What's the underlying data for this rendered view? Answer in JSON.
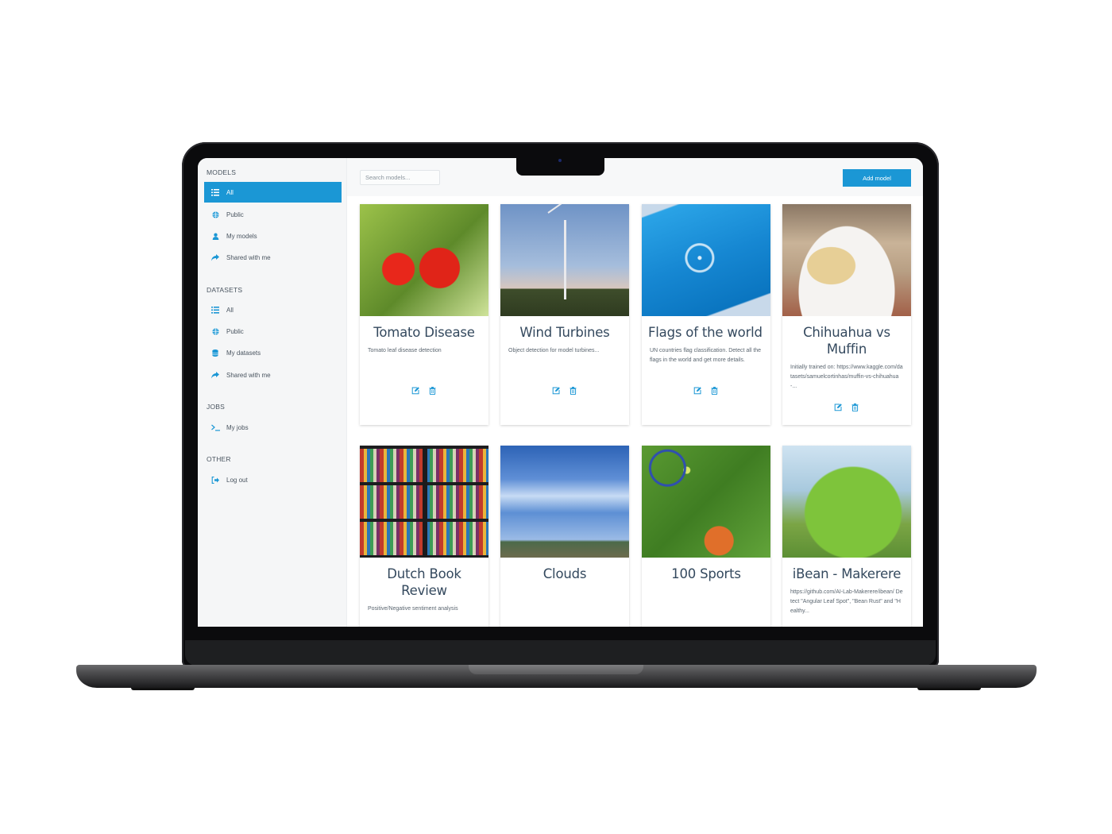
{
  "sidebar": {
    "sections": [
      {
        "title": "MODELS",
        "items": [
          {
            "label": "All",
            "icon": "list-icon",
            "active": true
          },
          {
            "label": "Public",
            "icon": "globe-icon"
          },
          {
            "label": "My models",
            "icon": "user-icon"
          },
          {
            "label": "Shared with me",
            "icon": "share-icon"
          }
        ]
      },
      {
        "title": "DATASETS",
        "items": [
          {
            "label": "All",
            "icon": "list-icon"
          },
          {
            "label": "Public",
            "icon": "globe-icon"
          },
          {
            "label": "My datasets",
            "icon": "database-icon"
          },
          {
            "label": "Shared with me",
            "icon": "share-icon"
          }
        ]
      },
      {
        "title": "JOBS",
        "items": [
          {
            "label": "My jobs",
            "icon": "terminal-icon"
          }
        ]
      },
      {
        "title": "OTHER",
        "items": [
          {
            "label": "Log out",
            "icon": "sign-out-icon"
          }
        ]
      }
    ]
  },
  "topbar": {
    "search_placeholder": "Search models...",
    "search_value": "",
    "add_button_label": "Add model"
  },
  "colors": {
    "accent": "#1b97d5",
    "title_text": "#34495e",
    "sidebar_bg": "#f5f6f7"
  },
  "models": [
    {
      "title": "Tomato Disease",
      "description": "Tomato leaf disease detection",
      "image": "tomatoes"
    },
    {
      "title": "Wind Turbines",
      "description": "Object detection for model turbines...",
      "image": "wind-turbines"
    },
    {
      "title": "Flags of the world",
      "description": "UN countries flag classification. Detect all the flags in the world and get more details.",
      "image": "un-flag"
    },
    {
      "title": "Chihuahua vs Muffin",
      "description": "Initially trained on: https://www.kaggle.com/datasets/samuelcortinhas/muffin-vs-chihuahua-...",
      "image": "muffin"
    },
    {
      "title": "Dutch Book Review",
      "description": "Positive/Negative sentiment analysis",
      "image": "bookshelf"
    },
    {
      "title": "Clouds",
      "description": "",
      "image": "clouds"
    },
    {
      "title": "100 Sports",
      "description": "",
      "image": "sports-equipment"
    },
    {
      "title": "iBean - Makerere",
      "description": "https://github.com/AI-Lab-Makerere/ibean/ Detect \"Angular Leaf Spot\", \"Bean Rust\" and \"Healthy...",
      "image": "bean-leaf"
    }
  ],
  "card_actions": {
    "edit": "edit-icon",
    "delete": "trash-icon"
  }
}
